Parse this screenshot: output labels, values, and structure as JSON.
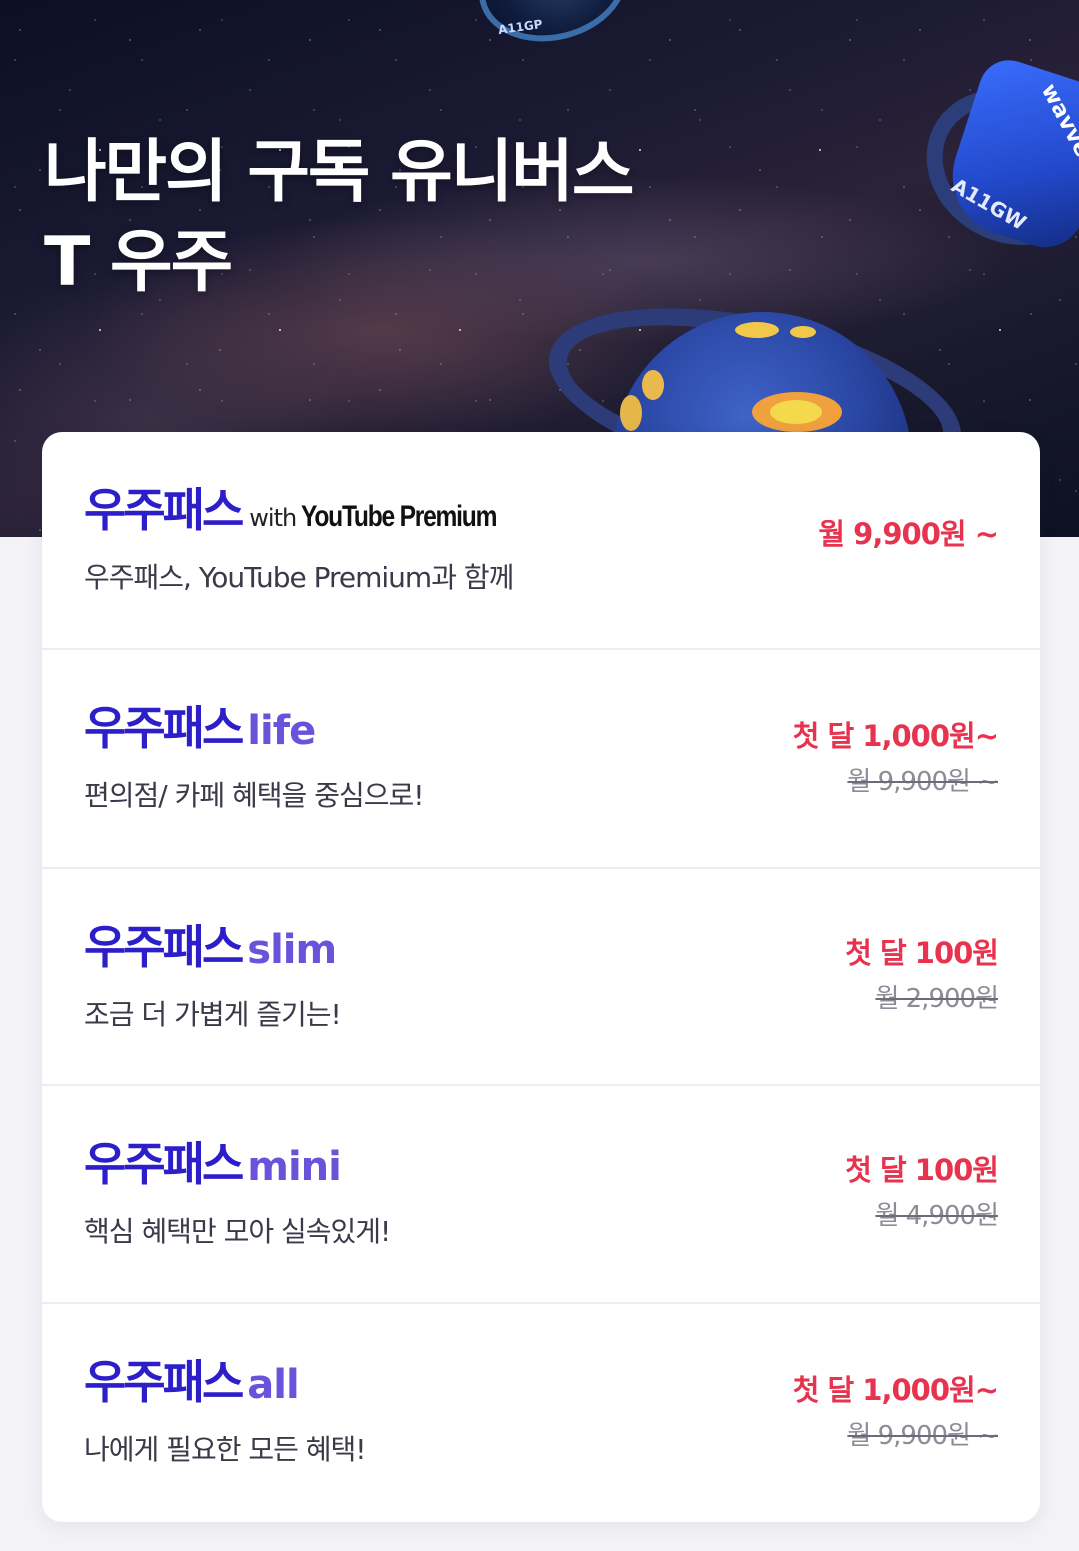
{
  "hero": {
    "title_line1": "나만의 구독 유니버스",
    "title_line2": "T 우주",
    "decor_top_text": "A11GP",
    "decor_right_brand": "wavve",
    "decor_right_ring": "A11GW"
  },
  "brand": {
    "name": "우주패스",
    "accent_color": "#2c1ec9",
    "suffix_color": "#6b52db",
    "price_color": "#e8334f"
  },
  "plans": [
    {
      "brand": "우주패스",
      "with": "with",
      "suffix": "YouTube Premium",
      "desc": "우주패스, YouTube Premium과 함께",
      "price": "월 9,900원 ~",
      "orig_price": ""
    },
    {
      "brand": "우주패스",
      "suffix": "life",
      "desc": "편의점/ 카페 혜택을 중심으로!",
      "price": "첫 달 1,000원~",
      "orig_price": "월 9,900원 ~"
    },
    {
      "brand": "우주패스",
      "suffix": "slim",
      "desc": "조금 더 가볍게 즐기는!",
      "price": "첫 달 100원",
      "orig_price": "월 2,900원"
    },
    {
      "brand": "우주패스",
      "suffix": "mini",
      "desc": "핵심 혜택만 모아 실속있게!",
      "price": "첫 달 100원",
      "orig_price": "월 4,900원"
    },
    {
      "brand": "우주패스",
      "suffix": "all",
      "desc": "나에게 필요한 모든 혜택!",
      "price": "첫 달 1,000원~",
      "orig_price": "월 9,900원 ~"
    }
  ]
}
